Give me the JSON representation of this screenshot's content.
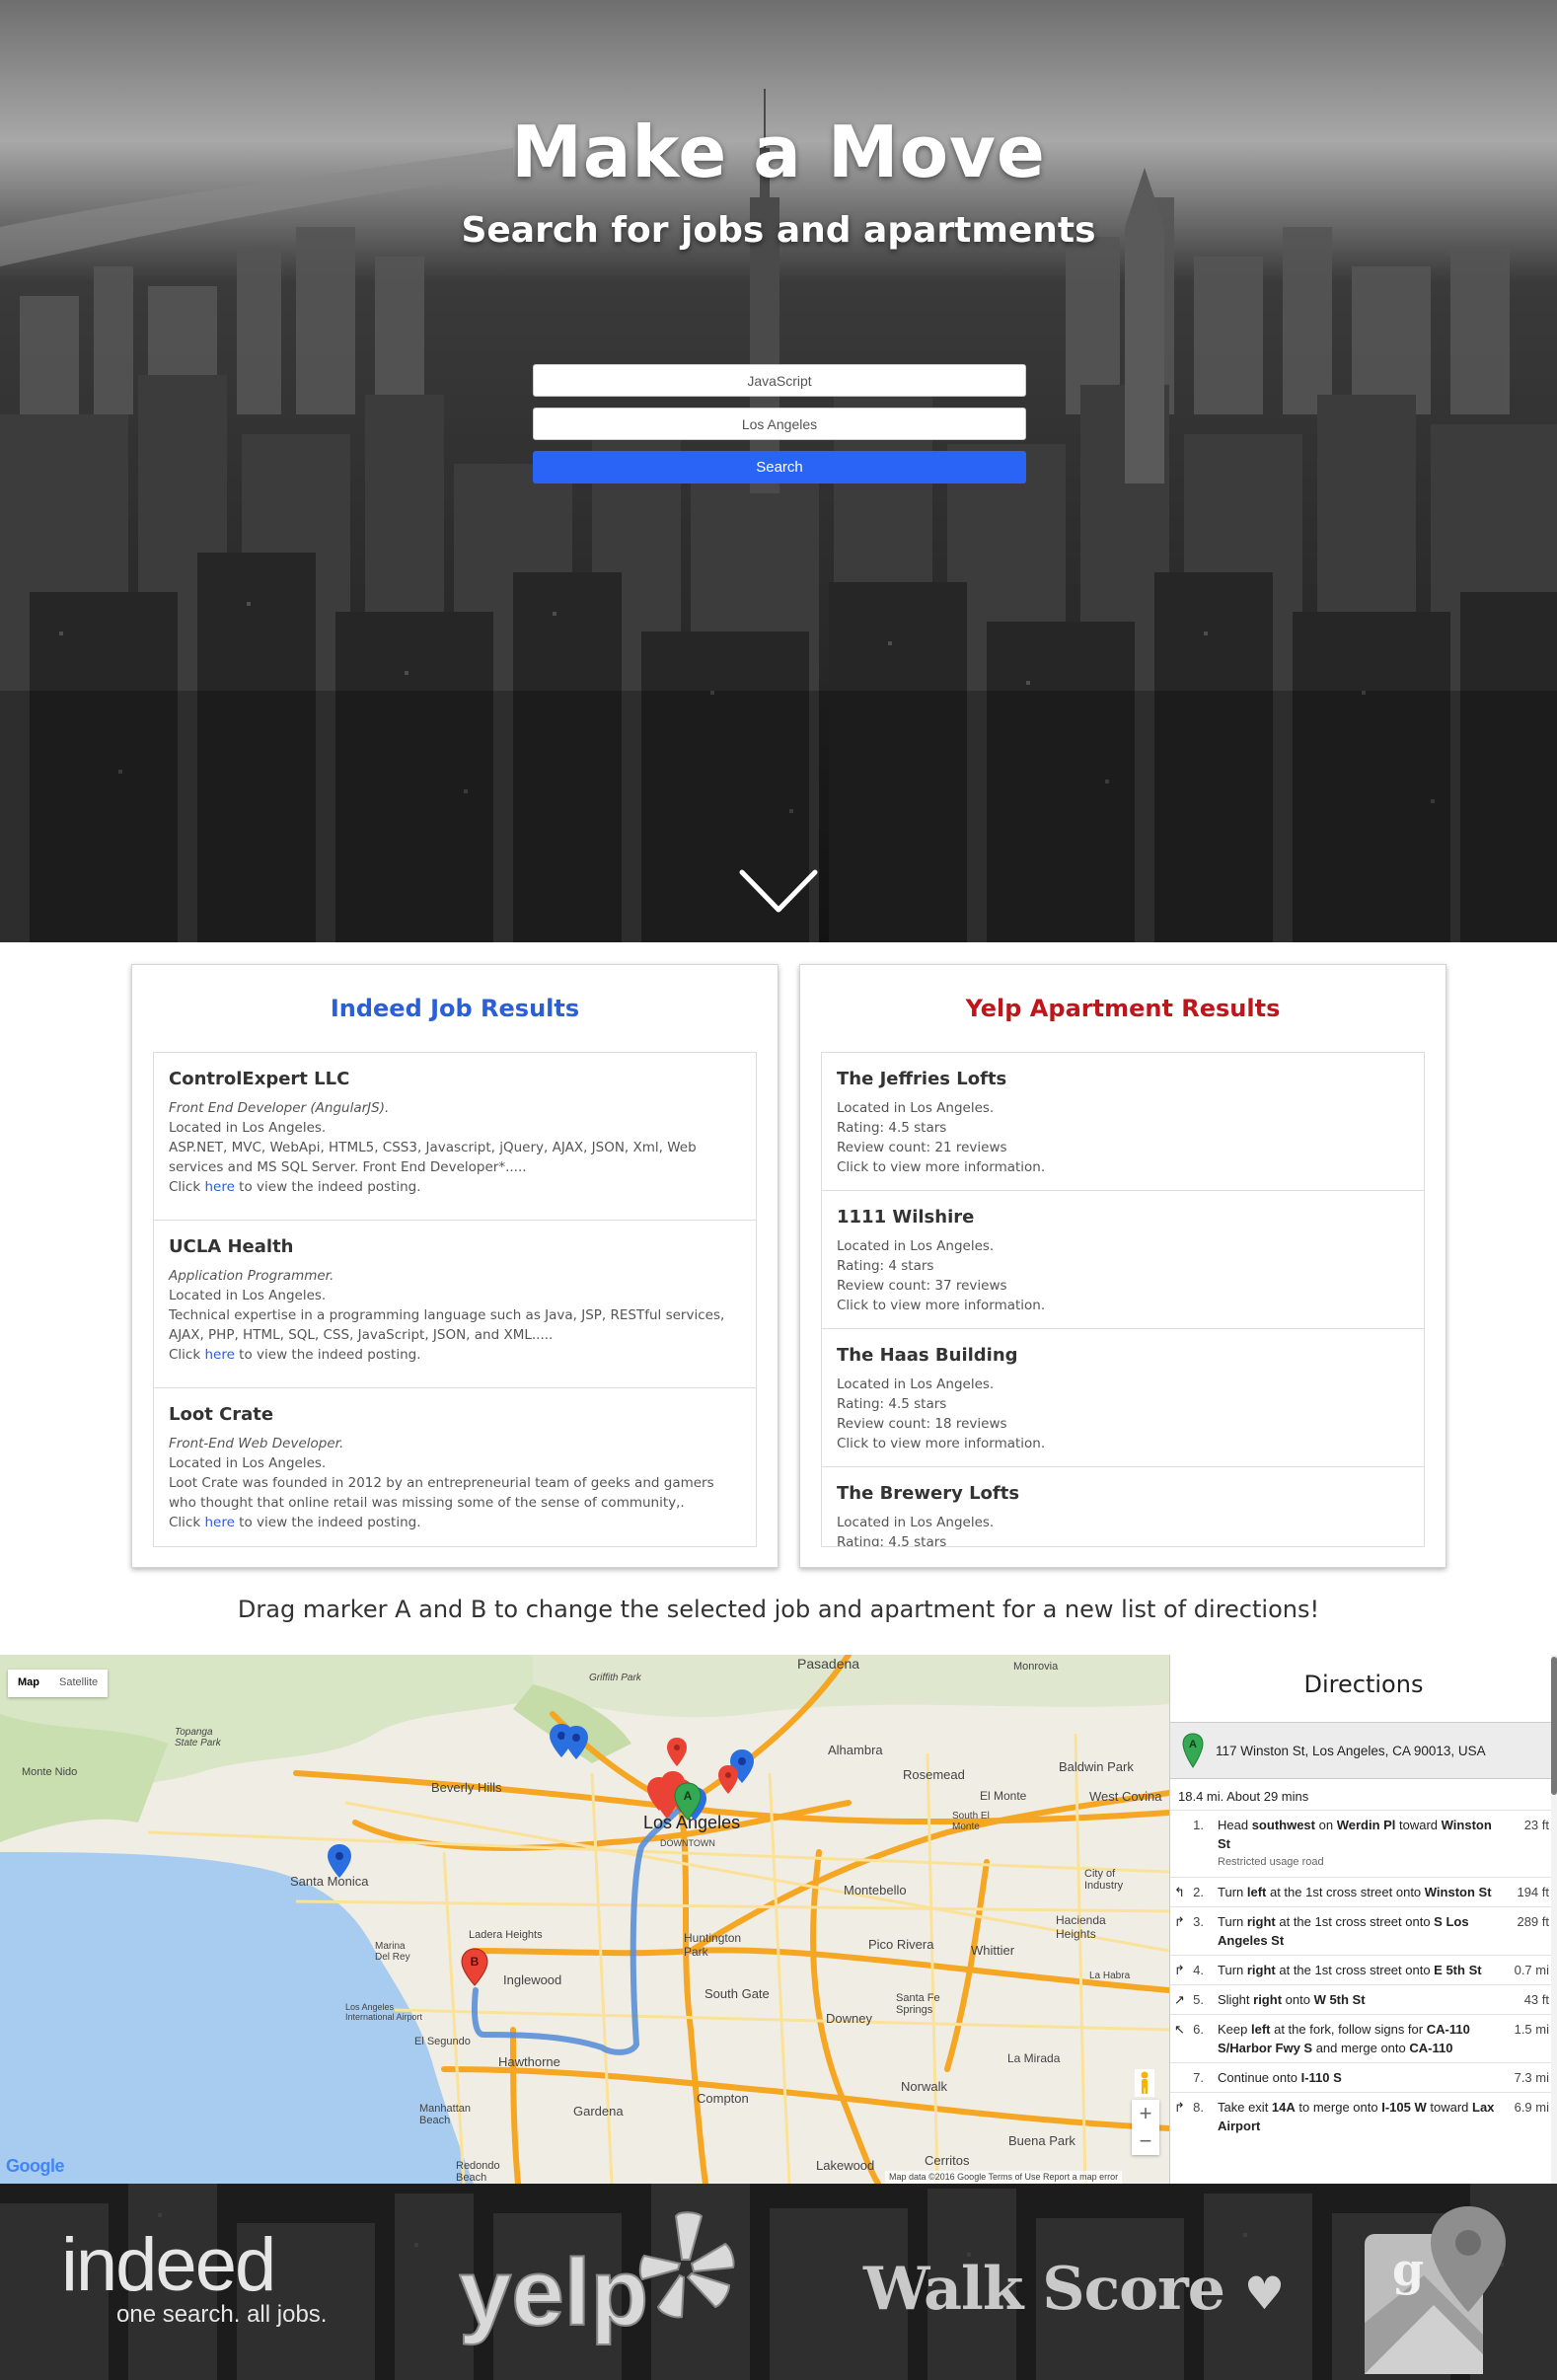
{
  "hero": {
    "title": "Make a Move",
    "subtitle": "Search for jobs and apartments",
    "job_query": "JavaScript",
    "location_query": "Los Angeles",
    "search_label": "Search",
    "search_button_color": "#2a64f6"
  },
  "jobs_panel": {
    "title": "Indeed Job Results",
    "title_color": "#2a5fd6",
    "items": [
      {
        "company": "ControlExpert LLC",
        "position": "Front End Developer (AngularJS).",
        "location": "Located in Los Angeles.",
        "snippet": "ASP.NET, MVC, WebApi, HTML5, CSS3, Javascript, jQuery, AJAX, JSON, Xml, Web services and MS SQL Server. Front End Developer*.....",
        "click_prefix": "Click ",
        "link_text": "here",
        "click_suffix": " to view the indeed posting."
      },
      {
        "company": "UCLA Health",
        "position": "Application Programmer.",
        "location": "Located in Los Angeles.",
        "snippet": "Technical expertise in a programming language such as Java, JSP, RESTful services, AJAX, PHP, HTML, SQL, CSS, JavaScript, JSON, and XML.....",
        "click_prefix": "Click ",
        "link_text": "here",
        "click_suffix": " to view the indeed posting."
      },
      {
        "company": "Loot Crate",
        "position": "Front-End Web Developer.",
        "location": "Located in Los Angeles.",
        "snippet": "Loot Crate was founded in 2012 by an entrepreneurial team of geeks and gamers who thought that online retail was missing some of the sense of community,.",
        "click_prefix": "Click ",
        "link_text": "here",
        "click_suffix": " to view the indeed posting."
      }
    ]
  },
  "apts_panel": {
    "title": "Yelp Apartment Results",
    "title_color": "#c0161b",
    "items": [
      {
        "name": "The Jeffries Lofts",
        "location": "Located in Los Angeles.",
        "rating": "Rating: 4.5 stars",
        "reviews": "Review count: 21 reviews",
        "more": "Click to view more information."
      },
      {
        "name": "1111 Wilshire",
        "location": "Located in Los Angeles.",
        "rating": "Rating: 4 stars",
        "reviews": "Review count: 37 reviews",
        "more": "Click to view more information."
      },
      {
        "name": "The Haas Building",
        "location": "Located in Los Angeles.",
        "rating": "Rating: 4.5 stars",
        "reviews": "Review count: 18 reviews",
        "more": "Click to view more information."
      },
      {
        "name": "The Brewery Lofts",
        "location": "Located in Los Angeles.",
        "rating": "Rating: 4.5 stars",
        "reviews": "",
        "more": ""
      }
    ]
  },
  "instructions": "Drag marker A and B to change the selected job and apartment for a new list of directions!",
  "map": {
    "type_map": "Map",
    "type_satellite": "Satellite",
    "zoom_in": "+",
    "zoom_out": "−",
    "google": "Google",
    "attribution": "Map data ©2016 Google    Terms of Use    Report a map error",
    "marker_a": "A",
    "marker_b": "B",
    "labels": {
      "pasadena": "Pasadena",
      "monrovia": "Monrovia",
      "griffith": "Griffith Park",
      "alhambra": "Alhambra",
      "rosemead": "Rosemead",
      "baldwin": "Baldwin Park",
      "west_covina": "West Covina",
      "el_monte": "El Monte",
      "south_el_monte": "South El Monte",
      "monte_nido": "Monte Nido",
      "beverly": "Beverly Hills",
      "los_angeles": "Los Angeles",
      "downtown": "DOWNTOWN",
      "santa_monica": "Santa Monica",
      "montebello": "Montebello",
      "industry": "City of Industry",
      "hacienda": "Hacienda Heights",
      "pico": "Pico Rivera",
      "whittier": "Whittier",
      "la_habra": "La Habra",
      "huntington": "Huntington Park",
      "ladera": "Ladera Heights",
      "inglewood": "Inglewood",
      "marina": "Marina Del Rey",
      "lax": "Los Angeles International Airport",
      "el_segundo": "El Segundo",
      "hawthorne": "Hawthorne",
      "south_gate": "South Gate",
      "downey": "Downey",
      "santa_fe": "Santa Fe Springs",
      "la_mirada": "La Mirada",
      "norwalk": "Norwalk",
      "compton": "Compton",
      "gardena": "Gardena",
      "manhattan": "Manhattan Beach",
      "redondo": "Redondo Beach",
      "lakewood": "Lakewood",
      "cerritos": "Cerritos",
      "buena_park": "Buena Park",
      "topanga": "Topanga State Park"
    }
  },
  "directions": {
    "title": "Directions",
    "start_address": "117 Winston St, Los Angeles, CA 90013, USA",
    "summary": "18.4 mi. About 29 mins",
    "steps": [
      {
        "num": "1.",
        "icon": "",
        "text_html": "Head <b>southwest</b> on <b>Werdin Pl</b> toward <b>Winston St</b>",
        "note": "Restricted usage road",
        "dist": "23 ft"
      },
      {
        "num": "2.",
        "icon": "turn-left-icon",
        "text_html": "Turn <b>left</b> at the 1st cross street onto <b>Winston St</b>",
        "note": "",
        "dist": "194 ft"
      },
      {
        "num": "3.",
        "icon": "turn-right-icon",
        "text_html": "Turn <b>right</b> at the 1st cross street onto <b>S Los Angeles St</b>",
        "note": "",
        "dist": "289 ft"
      },
      {
        "num": "4.",
        "icon": "turn-right-icon",
        "text_html": "Turn <b>right</b> at the 1st cross street onto <b>E 5th St</b>",
        "note": "",
        "dist": "0.7 mi"
      },
      {
        "num": "5.",
        "icon": "slight-right-icon",
        "text_html": "Slight <b>right</b> onto <b>W 5th St</b>",
        "note": "",
        "dist": "43 ft"
      },
      {
        "num": "6.",
        "icon": "keep-left-icon",
        "text_html": "Keep <b>left</b> at the fork, follow signs for <b>CA-110 S/Harbor Fwy S</b> and merge onto <b>CA-110</b>",
        "note": "",
        "dist": "1.5 mi"
      },
      {
        "num": "7.",
        "icon": "",
        "text_html": "Continue onto <b>I-110 S</b>",
        "note": "",
        "dist": "7.3 mi"
      },
      {
        "num": "8.",
        "icon": "turn-right-icon",
        "text_html": "Take exit <b>14A</b> to merge onto <b>I-105 W</b> toward <b>Lax Airport</b>",
        "note": "",
        "dist": "6.9 mi"
      }
    ]
  },
  "footer": {
    "indeed_word": "indeed",
    "indeed_tagline": "one search. all jobs.",
    "yelp_word": "yelp",
    "walkscore_word": "Walk Score",
    "walkscore_heart": "♥",
    "gmaps_letter": "g"
  }
}
